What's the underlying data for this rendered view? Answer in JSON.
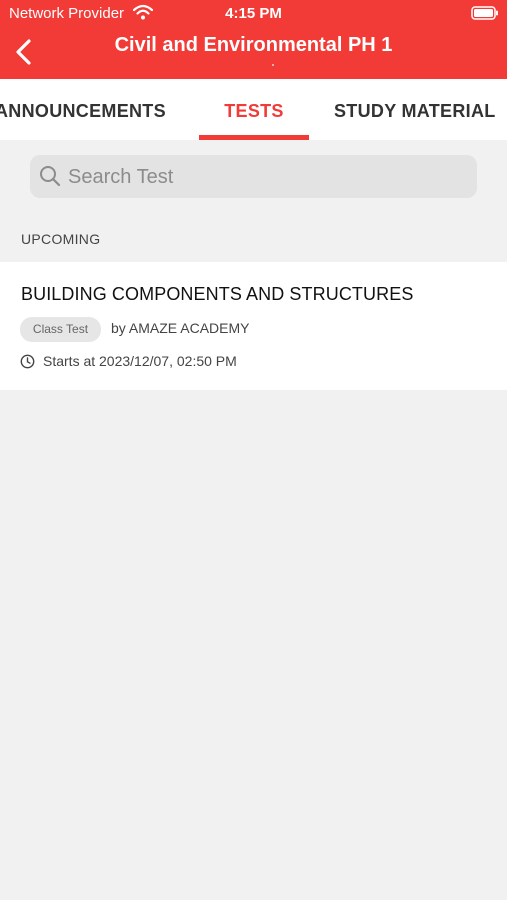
{
  "status_bar": {
    "carrier": "Network Provider",
    "time": "4:15 PM",
    "wifi_icon": "wifi-icon",
    "battery_icon": "battery-icon"
  },
  "header": {
    "title": "Civil and Environmental PH 1",
    "back_icon": "chevron-left-icon",
    "background_color": "#f23a37"
  },
  "tabs": [
    {
      "label": "ANNOUNCEMENTS",
      "active": false
    },
    {
      "label": "TESTS",
      "active": true
    },
    {
      "label": "STUDY MATERIAL",
      "active": false
    }
  ],
  "search": {
    "placeholder": "Search Test",
    "icon": "search-icon"
  },
  "upcoming": {
    "section_label": "UPCOMING",
    "tests": [
      {
        "title": "BUILDING COMPONENTS AND STRUCTURES",
        "badge": "Class Test",
        "author": "by AMAZE ACADEMY",
        "starts": "Starts at 2023/12/07, 02:50 PM",
        "clock_icon": "clock-icon"
      }
    ]
  },
  "colors": {
    "accent": "#f23a37",
    "background": "#f1f1f1",
    "card": "#ffffff"
  }
}
